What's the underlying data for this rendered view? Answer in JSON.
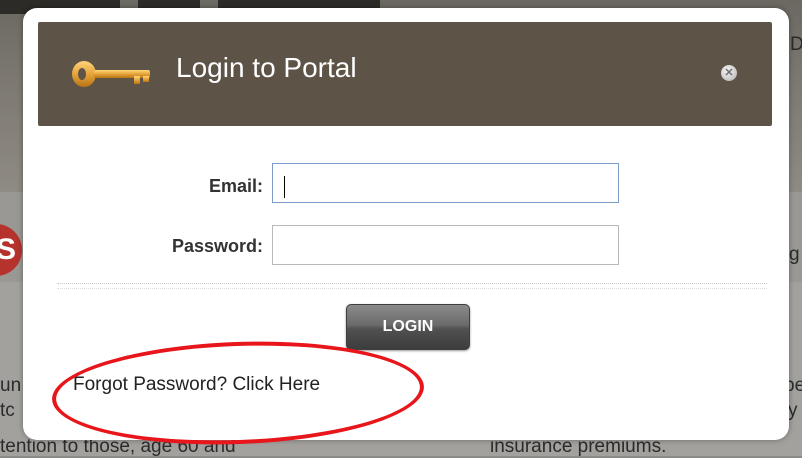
{
  "modal": {
    "title": "Login to Portal",
    "email_label": "Email:",
    "email_value": "",
    "password_label": "Password:",
    "password_value": "",
    "login_label": "LOGIN",
    "forgot_label": "Forgot Password? Click Here",
    "close_icon": "close-icon",
    "header_icon": "key-icon"
  },
  "background": {
    "left_fragments": [
      "un",
      "tc",
      "tention to those, age 60 and"
    ],
    "right_fragments": [
      "D",
      "g",
      "be",
      "y",
      "insurance premiums."
    ],
    "badge_letter": "S"
  },
  "colors": {
    "header_bg": "#5e5347",
    "key_gold": "#e5a43a",
    "annotation_red": "#e8151b"
  }
}
